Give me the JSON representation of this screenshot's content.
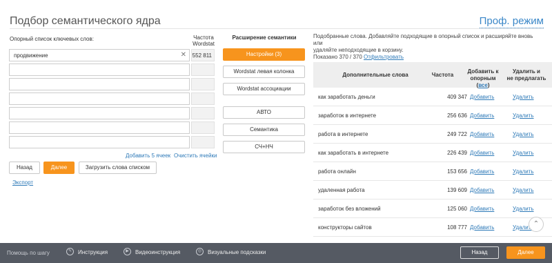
{
  "header": {
    "title": "Подбор семантического ядра",
    "prof_mode": "Проф. режим"
  },
  "left": {
    "keywords_label": "Опорный список ключевых слов:",
    "freq_label_1": "Частота",
    "freq_label_2": "Wordstat",
    "rows": [
      {
        "value": "продвижение",
        "freq": "552 811"
      },
      {
        "value": "",
        "freq": ""
      },
      {
        "value": "",
        "freq": ""
      },
      {
        "value": "",
        "freq": ""
      },
      {
        "value": "",
        "freq": ""
      },
      {
        "value": "",
        "freq": ""
      },
      {
        "value": "",
        "freq": ""
      }
    ],
    "add5": "Добавить 5 ячеек",
    "clear": "Очистить ячейки",
    "back": "Назад",
    "next": "Далее",
    "upload": "Загрузить слова списком",
    "export": "Экспорт"
  },
  "middle": {
    "heading": "Расширение семантики",
    "buttons": [
      "Настройки (3)",
      "Wordstat левая колонка",
      "Wordstat ассоциации",
      "АВТО",
      "Семантика",
      "СЧ+НЧ"
    ]
  },
  "right": {
    "info_line1": "Подобранные слова. Добавляйте подходящие в опорный список и расширяйте вновь или",
    "info_line2": "удаляйте неподходящие в корзину.",
    "shown": "Показано 370 / 370",
    "filter": "Отфильтровать",
    "columns": {
      "words": "Дополнительные слова",
      "freq": "Частота",
      "add_1": "Добавить к",
      "add_2a": "опорным (",
      "add_2b": "все",
      "add_2c": ")",
      "del_1": "Удалить и",
      "del_2": "не предлагать"
    },
    "rows": [
      {
        "word": "как заработать деньги",
        "freq": "409 347",
        "add": "Добавить",
        "del": "Удалить"
      },
      {
        "word": "заработок в интернете",
        "freq": "256 636",
        "add": "Добавить",
        "del": "Удалить"
      },
      {
        "word": "работа в интернете",
        "freq": "249 722",
        "add": "Добавить",
        "del": "Удалить"
      },
      {
        "word": "как заработать в интернете",
        "freq": "226 439",
        "add": "Добавить",
        "del": "Удалить"
      },
      {
        "word": "работа онлайн",
        "freq": "153 656",
        "add": "Добавить",
        "del": "Удалить"
      },
      {
        "word": "удаленная работа",
        "freq": "139 609",
        "add": "Добавить",
        "del": "Удалить"
      },
      {
        "word": "заработок без вложений",
        "freq": "125 060",
        "add": "Добавить",
        "del": "Удалить"
      },
      {
        "word": "конструкторы сайтов",
        "freq": "108 777",
        "add": "Добавить",
        "del": "Удалить"
      }
    ]
  },
  "footer": {
    "help": "Помощь по шагу",
    "instruction": "Инструкция",
    "video": "Видеоинструкция",
    "hints": "Визуальные подсказки",
    "back": "Назад",
    "next": "Далее"
  },
  "colors": {
    "accent": "#f7941d",
    "link": "#2e7ab8",
    "footer": "#555a63"
  }
}
